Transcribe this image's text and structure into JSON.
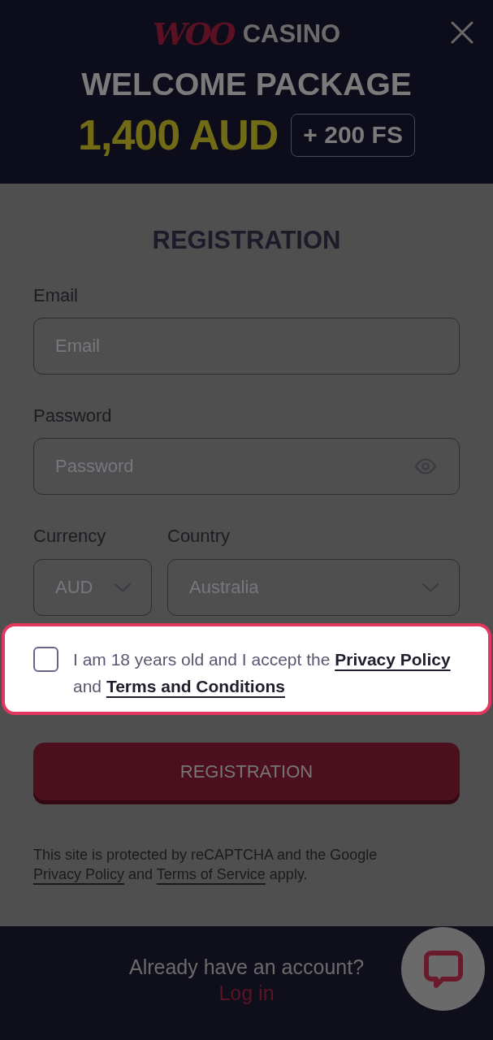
{
  "header": {
    "logo": {
      "script": "WOO",
      "text": "CASINO"
    },
    "title": "WELCOME PACKAGE",
    "bonus_amount": "1,400 AUD",
    "bonus_badge": "+ 200 FS"
  },
  "form": {
    "title": "REGISTRATION",
    "fields": [
      {
        "kind": "email",
        "label": "Email",
        "placeholder": "Email"
      },
      {
        "kind": "password",
        "label": "Password",
        "placeholder": "Password"
      }
    ],
    "selects": [
      {
        "label": "Currency",
        "value": "AUD"
      },
      {
        "label": "Country",
        "value": "Australia"
      }
    ],
    "consent": {
      "checked": false,
      "highlighted": true,
      "parts": [
        {
          "kind": "text",
          "text": "I am 18 years old and I accept the"
        },
        {
          "kind": "link",
          "text": "Privacy Policy"
        },
        {
          "kind": "text",
          "text": "and"
        },
        {
          "kind": "link",
          "text": "Terms and Conditions"
        }
      ]
    },
    "submit": {
      "label": "REGISTRATION"
    },
    "recaptcha_note": {
      "parts": [
        {
          "kind": "text",
          "text": "This site is protected by reCAPTCHA and the Google"
        },
        {
          "kind": "link",
          "text": "Privacy Policy"
        },
        {
          "kind": "text",
          "text": "and"
        },
        {
          "kind": "link",
          "text": "Terms of Service"
        },
        {
          "kind": "text",
          "text": "apply."
        }
      ]
    }
  },
  "footer": {
    "prompt": "Already have an account?",
    "link": "Log in"
  }
}
